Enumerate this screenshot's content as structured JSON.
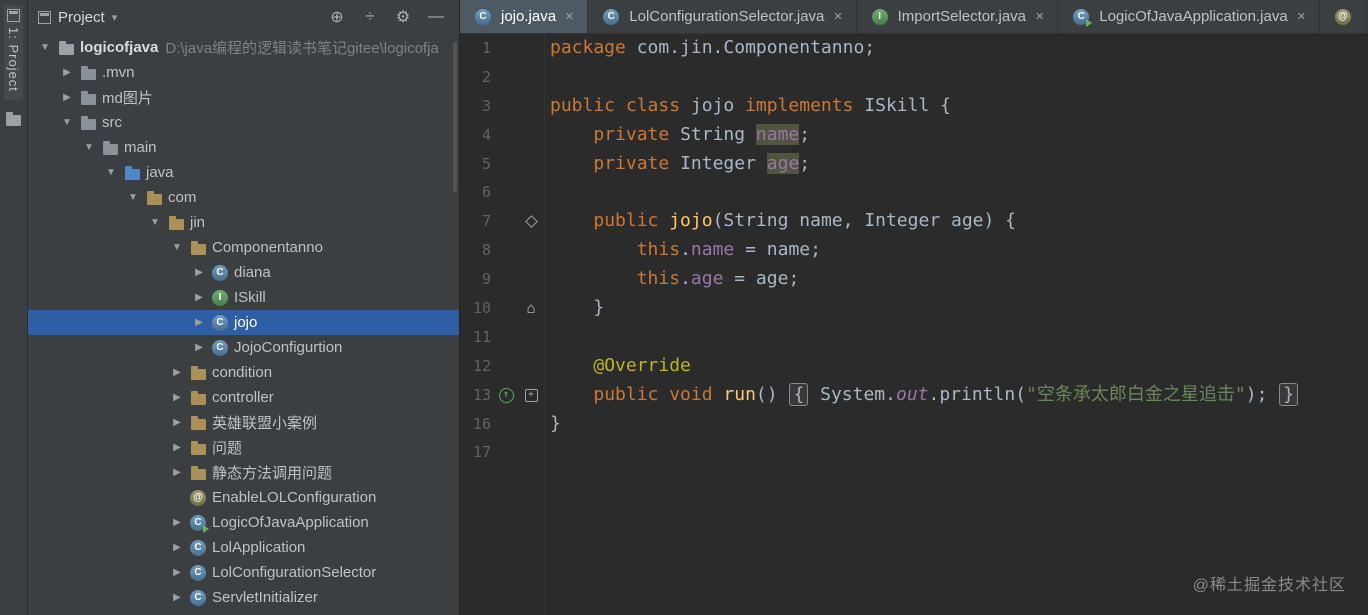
{
  "glyphs": {
    "arrow_open": "▼",
    "arrow_closed": "▶",
    "caret_down": "▾",
    "close": "✕",
    "locate": "⊕",
    "collapse_all": "÷",
    "settings": "⚙",
    "hide": "—",
    "home": "⌂",
    "plus": "+",
    "up_arrow": "↑"
  },
  "colors": {
    "selection_blue": "#2e5fa5",
    "panel_bg": "#3c3f41",
    "editor_bg": "#2b2b2b",
    "keyword": "#cc7832",
    "plain": "#a9b7c6",
    "field": "#9876aa",
    "method": "#ffc66d",
    "string": "#6a8759",
    "annotation": "#bbb529"
  },
  "tool_strip": {
    "project_button": "1: Project"
  },
  "project_panel": {
    "title": "Project",
    "tree": [
      {
        "label": "logicofjava",
        "path": "D:\\java编程的逻辑读书笔记gitee\\logicofja",
        "level": 0,
        "arrow": "open",
        "icon": "project",
        "bold": true
      },
      {
        "label": ".mvn",
        "level": 1,
        "arrow": "closed",
        "icon": "folder"
      },
      {
        "label": "md图片",
        "level": 1,
        "arrow": "closed",
        "icon": "folder"
      },
      {
        "label": "src",
        "level": 1,
        "arrow": "open",
        "icon": "folder"
      },
      {
        "label": "main",
        "level": 2,
        "arrow": "open",
        "icon": "folder"
      },
      {
        "label": "java",
        "level": 3,
        "arrow": "open",
        "icon": "src-folder"
      },
      {
        "label": "com",
        "level": 4,
        "arrow": "open",
        "icon": "package"
      },
      {
        "label": "jin",
        "level": 5,
        "arrow": "open",
        "icon": "package"
      },
      {
        "label": "Componentanno",
        "level": 6,
        "arrow": "open",
        "icon": "package"
      },
      {
        "label": "diana",
        "level": 7,
        "arrow": "closed",
        "icon": "class"
      },
      {
        "label": "ISkill",
        "level": 7,
        "arrow": "closed",
        "icon": "interface"
      },
      {
        "label": "jojo",
        "level": 7,
        "arrow": "closed",
        "icon": "class",
        "selected": true
      },
      {
        "label": "JojoConfigurtion",
        "level": 7,
        "arrow": "closed",
        "icon": "class"
      },
      {
        "label": "condition",
        "level": 6,
        "arrow": "closed",
        "icon": "package"
      },
      {
        "label": "controller",
        "level": 6,
        "arrow": "closed",
        "icon": "package"
      },
      {
        "label": "英雄联盟小案例",
        "level": 6,
        "arrow": "closed",
        "icon": "package"
      },
      {
        "label": "问题",
        "level": 6,
        "arrow": "closed",
        "icon": "package"
      },
      {
        "label": "静态方法调用问题",
        "level": 6,
        "arrow": "closed",
        "icon": "package"
      },
      {
        "label": "EnableLOLConfiguration",
        "level": 6,
        "arrow": "none",
        "icon": "annotation"
      },
      {
        "label": "LogicOfJavaApplication",
        "level": 6,
        "arrow": "closed",
        "icon": "run-class"
      },
      {
        "label": "LolApplication",
        "level": 6,
        "arrow": "closed",
        "icon": "class"
      },
      {
        "label": "LolConfigurationSelector",
        "level": 6,
        "arrow": "closed",
        "icon": "class"
      },
      {
        "label": "ServletInitializer",
        "level": 6,
        "arrow": "closed",
        "icon": "class"
      }
    ]
  },
  "tabs": [
    {
      "label": "jojo.java",
      "icon": "class",
      "active": true
    },
    {
      "label": "LolConfigurationSelector.java",
      "icon": "class"
    },
    {
      "label": "ImportSelector.java",
      "icon": "interface"
    },
    {
      "label": "LogicOfJavaApplication.java",
      "icon": "run-class"
    },
    {
      "label": "",
      "icon": "annotation",
      "partial": true
    }
  ],
  "editor": {
    "lines": [
      {
        "num": "1",
        "tokens": [
          [
            "kw",
            "package "
          ],
          [
            "pl",
            "com.jin.Componentanno;"
          ]
        ]
      },
      {
        "num": "2",
        "tokens": []
      },
      {
        "num": "3",
        "tokens": [
          [
            "kw",
            "public class "
          ],
          [
            "pl",
            "jojo "
          ],
          [
            "kw",
            "implements "
          ],
          [
            "pl",
            "ISkill {"
          ]
        ]
      },
      {
        "num": "4",
        "tokens": [
          [
            "pl",
            "    "
          ],
          [
            "kw",
            "private "
          ],
          [
            "pl",
            "String "
          ],
          [
            "hl",
            "name"
          ],
          [
            "pl",
            ";"
          ]
        ]
      },
      {
        "num": "5",
        "tokens": [
          [
            "pl",
            "    "
          ],
          [
            "kw",
            "private "
          ],
          [
            "pl",
            "Integer "
          ],
          [
            "hl",
            "age"
          ],
          [
            "pl",
            ";"
          ]
        ]
      },
      {
        "num": "6",
        "tokens": []
      },
      {
        "num": "7",
        "fold": "diamond",
        "tokens": [
          [
            "pl",
            "    "
          ],
          [
            "kw",
            "public "
          ],
          [
            "mth",
            "jojo"
          ],
          [
            "pl",
            "(String name, Integer age) {"
          ]
        ]
      },
      {
        "num": "8",
        "tokens": [
          [
            "pl",
            "        "
          ],
          [
            "kw",
            "this"
          ],
          [
            "pl",
            "."
          ],
          [
            "fld",
            "name"
          ],
          [
            "pl",
            " = name;"
          ]
        ]
      },
      {
        "num": "9",
        "tokens": [
          [
            "pl",
            "        "
          ],
          [
            "kw",
            "this"
          ],
          [
            "pl",
            "."
          ],
          [
            "fld",
            "age"
          ],
          [
            "pl",
            " = age;"
          ]
        ]
      },
      {
        "num": "10",
        "fold": "home",
        "tokens": [
          [
            "pl",
            "    }"
          ]
        ]
      },
      {
        "num": "11",
        "tokens": []
      },
      {
        "num": "12",
        "tokens": [
          [
            "pl",
            "    "
          ],
          [
            "ann",
            "@Override"
          ]
        ]
      },
      {
        "num": "13",
        "gutter": "override",
        "fold": "foldbox",
        "tokens": [
          [
            "pl",
            "    "
          ],
          [
            "kw",
            "public void "
          ],
          [
            "mth",
            "run"
          ],
          [
            "pl",
            "() "
          ],
          [
            "fbrace",
            "{"
          ],
          [
            "pl",
            " System."
          ],
          [
            "sf",
            "out"
          ],
          [
            "pl",
            ".println("
          ],
          [
            "str",
            "\"空条承太郎白金之星追击\""
          ],
          [
            "pl",
            "); "
          ],
          [
            "fbrace",
            "}"
          ]
        ]
      },
      {
        "num": "16",
        "tokens": [
          [
            "pl",
            "}"
          ]
        ]
      },
      {
        "num": "17",
        "tokens": []
      }
    ]
  },
  "watermark": "@稀土掘金技术社区"
}
